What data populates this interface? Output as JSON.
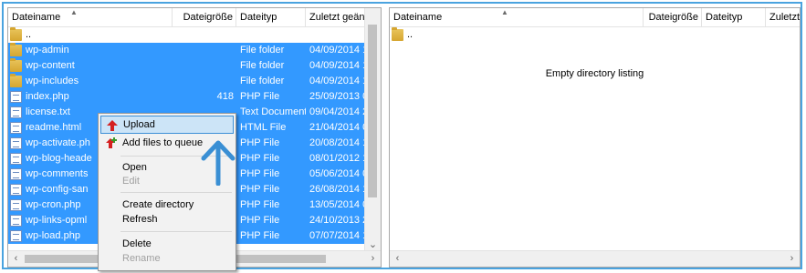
{
  "left_panel": {
    "columns": [
      "Dateiname",
      "Dateigröße",
      "Dateityp",
      "Zuletzt geän"
    ],
    "parent_dir": "..",
    "rows": [
      {
        "name": "wp-admin",
        "size": "",
        "type": "File folder",
        "modified": "04/09/2014 1",
        "icon": "folder-icon"
      },
      {
        "name": "wp-content",
        "size": "",
        "type": "File folder",
        "modified": "04/09/2014 1",
        "icon": "folder-icon"
      },
      {
        "name": "wp-includes",
        "size": "",
        "type": "File folder",
        "modified": "04/09/2014 1",
        "icon": "folder-icon"
      },
      {
        "name": "index.php",
        "size": "418",
        "type": "PHP File",
        "modified": "25/09/2013 0",
        "icon": "php-file-icon"
      },
      {
        "name": "license.txt",
        "size": "",
        "type": "Text Document",
        "modified": "09/04/2014 2",
        "icon": "text-file-icon"
      },
      {
        "name": "readme.html",
        "size": "",
        "type": "HTML File",
        "modified": "21/04/2014 0",
        "icon": "html-file-icon"
      },
      {
        "name": "wp-activate.ph",
        "size": "",
        "type": "PHP File",
        "modified": "20/08/2014 1",
        "icon": "php-file-icon"
      },
      {
        "name": "wp-blog-heade",
        "size": "",
        "type": "PHP File",
        "modified": "08/01/2012 1",
        "icon": "php-file-icon"
      },
      {
        "name": "wp-comments",
        "size": "",
        "type": "PHP File",
        "modified": "05/06/2014 0",
        "icon": "php-file-icon"
      },
      {
        "name": "wp-config-san",
        "size": "",
        "type": "PHP File",
        "modified": "26/08/2014 1",
        "icon": "php-file-icon"
      },
      {
        "name": "wp-cron.php",
        "size": "",
        "type": "PHP File",
        "modified": "13/05/2014 0",
        "icon": "php-file-icon"
      },
      {
        "name": "wp-links-opml",
        "size": "",
        "type": "PHP File",
        "modified": "24/10/2013 2",
        "icon": "php-file-icon"
      },
      {
        "name": "wp-load.php",
        "size": "",
        "type": "PHP File",
        "modified": "07/07/2014 1",
        "icon": "php-file-icon"
      }
    ]
  },
  "right_panel": {
    "columns": [
      "Dateiname",
      "Dateigröße",
      "Dateityp",
      "Zuletzt g"
    ],
    "parent_dir": "..",
    "empty_message": "Empty directory listing"
  },
  "context_menu": {
    "items": [
      {
        "label": "Upload",
        "enabled": true,
        "highlighted": true,
        "icon": "upload-arrow-icon"
      },
      {
        "label": "Add files to queue",
        "enabled": true,
        "icon": "add-to-queue-icon"
      },
      {
        "label": "Open",
        "enabled": true
      },
      {
        "label": "Edit",
        "enabled": false
      },
      {
        "label": "Create directory",
        "enabled": true
      },
      {
        "label": "Refresh",
        "enabled": true
      },
      {
        "label": "Delete",
        "enabled": true
      },
      {
        "label": "Rename",
        "enabled": false
      }
    ]
  },
  "colors": {
    "selection": "#3399ff",
    "frame": "#4aa3df",
    "annotation_arrow": "#3a8fd4",
    "upload_icon": "#d42020"
  }
}
